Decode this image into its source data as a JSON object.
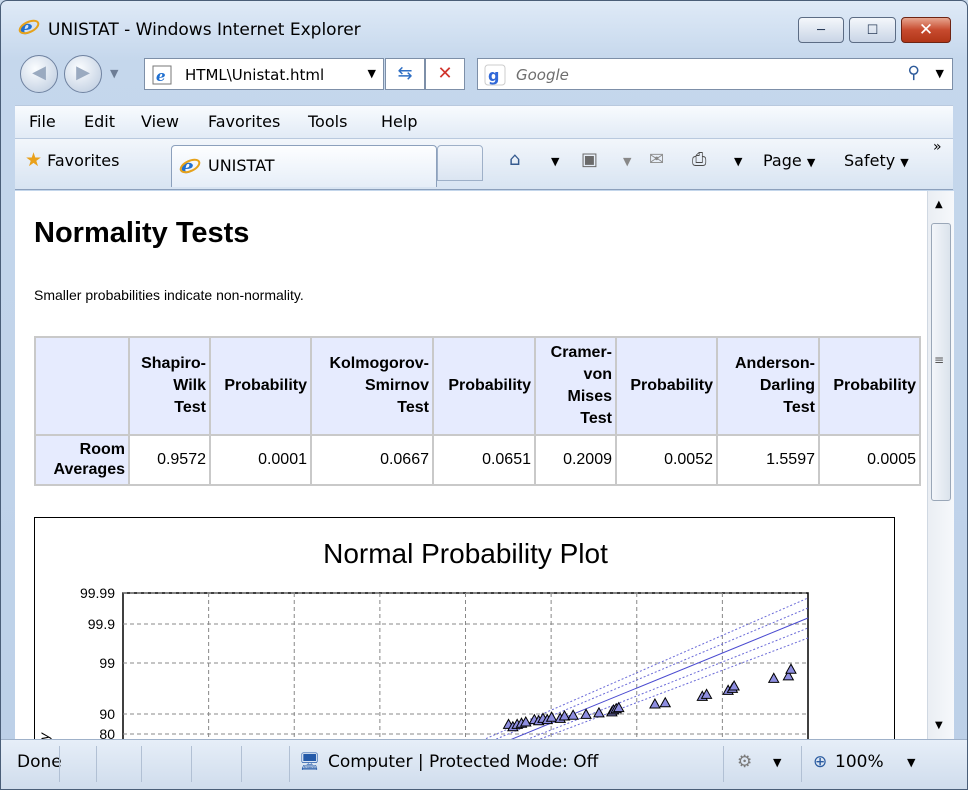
{
  "window": {
    "title": "UNISTAT - Windows Internet Explorer",
    "min": "─",
    "max": "☐",
    "close": "✕"
  },
  "address": {
    "value": "HTML\\Unistat.html"
  },
  "search": {
    "placeholder": "Google"
  },
  "menu": [
    "File",
    "Edit",
    "View",
    "Favorites",
    "Tools",
    "Help"
  ],
  "favbar": {
    "favorites": "Favorites",
    "tab": "UNISTAT",
    "page": "Page",
    "safety": "Safety",
    "more": "»"
  },
  "page": {
    "heading": "Normality Tests",
    "note": "Smaller probabilities indicate non-normality.",
    "table": {
      "headers": [
        "",
        "Shapiro-\nWilk\nTest",
        "Probability",
        "Kolmogorov-\nSmirnov\nTest",
        "Probability",
        "Cramer-\nvon\nMises\nTest",
        "Probability",
        "Anderson-\nDarling\nTest",
        "Probability"
      ],
      "row_label": "Room\nAverages",
      "values": [
        "0.9572",
        "0.0001",
        "0.0667",
        "0.0651",
        "0.2009",
        "0.0052",
        "1.5597",
        "0.0005"
      ]
    }
  },
  "chart_data": {
    "type": "scatter",
    "title": "Normal Probability Plot",
    "ytick_labels": [
      "99.99",
      "99.9",
      "99",
      "90",
      "80"
    ],
    "ylabel_partial": "y",
    "points": [
      [
        0.55,
        0.86
      ],
      [
        0.555,
        0.87
      ],
      [
        0.56,
        0.86
      ],
      [
        0.565,
        0.855
      ],
      [
        0.57,
        0.85
      ],
      [
        0.58,
        0.84
      ],
      [
        0.585,
        0.845
      ],
      [
        0.59,
        0.835
      ],
      [
        0.595,
        0.84
      ],
      [
        0.6,
        0.83
      ],
      [
        0.61,
        0.835
      ],
      [
        0.615,
        0.825
      ],
      [
        0.625,
        0.822
      ],
      [
        0.64,
        0.818
      ],
      [
        0.655,
        0.812
      ],
      [
        0.67,
        0.808
      ],
      [
        0.672,
        0.8
      ],
      [
        0.675,
        0.795
      ],
      [
        0.678,
        0.79
      ],
      [
        0.72,
        0.775
      ],
      [
        0.732,
        0.77
      ],
      [
        0.775,
        0.743
      ],
      [
        0.78,
        0.735
      ],
      [
        0.805,
        0.718
      ],
      [
        0.81,
        0.71
      ],
      [
        0.812,
        0.7
      ],
      [
        0.858,
        0.668
      ],
      [
        0.875,
        0.658
      ],
      [
        0.878,
        0.63
      ]
    ]
  },
  "status": {
    "done": "Done",
    "zone": "Computer | Protected Mode: Off",
    "zoom": "100%"
  }
}
